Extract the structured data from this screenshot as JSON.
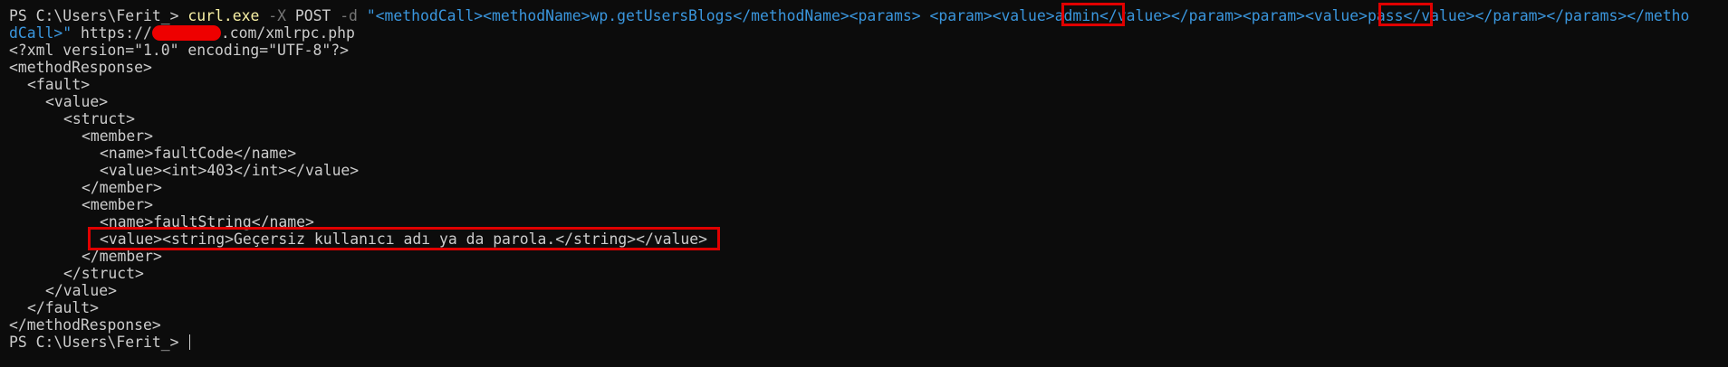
{
  "prompt": "PS C:\\Users\\Ferit_> ",
  "command": {
    "exe": "curl.exe",
    "flag_x": "-X",
    "method": "POST",
    "flag_d": "-d",
    "body_part1": "\"<methodCall><methodName>wp.getUsersBlogs</methodName><params> <param><value>",
    "username": "admin",
    "body_part2": "</value></param><param><value>",
    "password": "pass",
    "body_part3": "</value></param></params></metho",
    "body_wrap": "dCall>\"",
    "url_prefix": " https://",
    "url_suffix": ".com/xmlrpc.php"
  },
  "output": {
    "xml_decl": "<?xml version=\"1.0\" encoding=\"UTF-8\"?>",
    "l_methodResponse_open": "<methodResponse>",
    "l_fault_open": "<fault>",
    "l_value_open": "<value>",
    "l_struct_open": "<struct>",
    "l_member1_open": "<member>",
    "l_name_faultcode": "<name>faultCode</name>",
    "l_value_int": "<value><int>403</int></value>",
    "l_member1_close": "</member>",
    "l_member2_open": "<member>",
    "l_name_faultstring": "<name>faultString</name>",
    "l_value_string": "<value><string>Geçersiz kullanıcı adı ya da parola.</string></value>",
    "l_member2_close": "</member>",
    "l_struct_close": "</struct>",
    "l_value_close": "</value>",
    "l_fault_close": "</fault>",
    "l_methodResponse_close": "</methodResponse>"
  },
  "final_prompt": "PS C:\\Users\\Ferit_> ",
  "colors": {
    "background": "#0c0c0c",
    "text": "#cccccc",
    "command": "#f9f1a5",
    "parameter": "#767676",
    "string": "#3a96dd",
    "highlight": "#e00000"
  }
}
